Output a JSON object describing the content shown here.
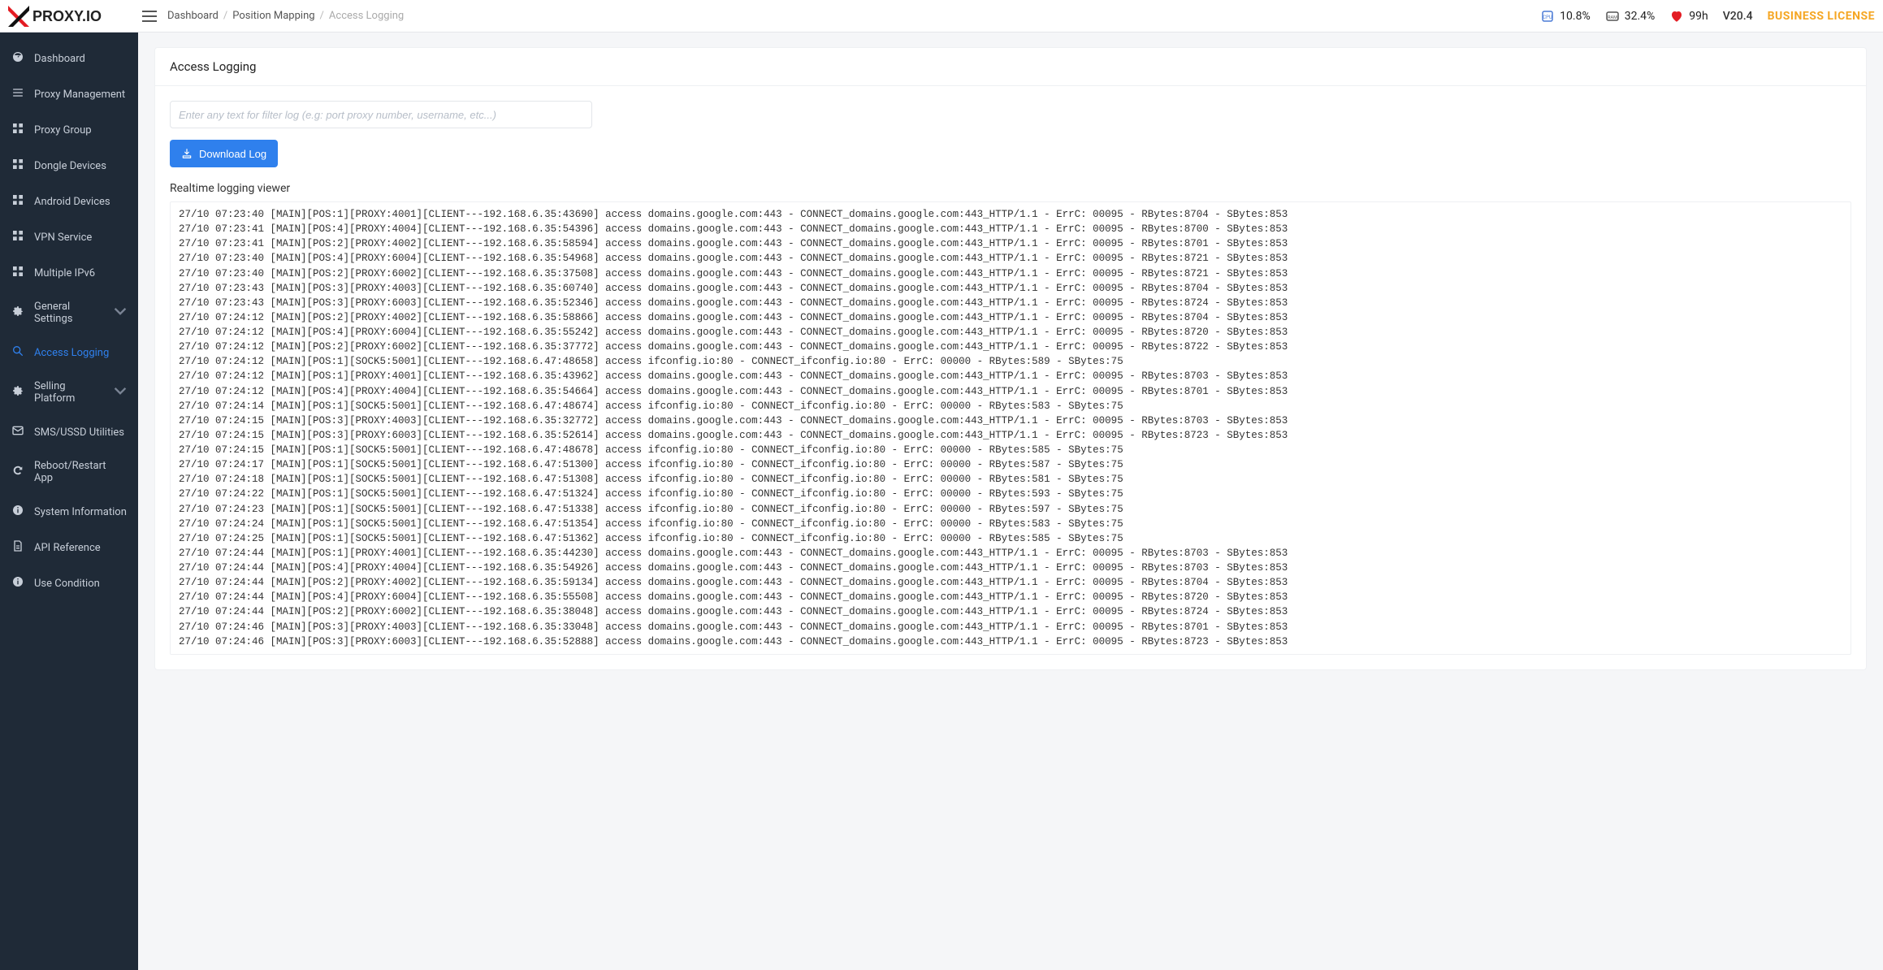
{
  "brand": {
    "name": "PROXY.IO"
  },
  "breadcrumb": {
    "items": [
      "Dashboard",
      "Position Mapping",
      "Access Logging"
    ]
  },
  "topStatus": {
    "cpu": "10.8%",
    "ram": "32.4%",
    "health": "99h",
    "version": "V20.4",
    "license": "BUSINESS LICENSE"
  },
  "sidebar": {
    "items": [
      {
        "icon": "speedometer",
        "label": "Dashboard",
        "chev": false
      },
      {
        "icon": "list",
        "label": "Proxy Management",
        "chev": false
      },
      {
        "icon": "grid",
        "label": "Proxy Group",
        "chev": false
      },
      {
        "icon": "grid",
        "label": "Dongle Devices",
        "chev": false
      },
      {
        "icon": "grid",
        "label": "Android Devices",
        "chev": false
      },
      {
        "icon": "grid",
        "label": "VPN Service",
        "chev": false
      },
      {
        "icon": "grid",
        "label": "Multiple IPv6",
        "chev": false
      },
      {
        "icon": "gear",
        "label": "General Settings",
        "chev": true
      },
      {
        "icon": "search",
        "label": "Access Logging",
        "chev": false,
        "active": true
      },
      {
        "icon": "gear",
        "label": "Selling Platform",
        "chev": true
      },
      {
        "icon": "envelope",
        "label": "SMS/USSD Utilities",
        "chev": false
      },
      {
        "icon": "refresh",
        "label": "Reboot/Restart App",
        "chev": false
      },
      {
        "icon": "info",
        "label": "System Information",
        "chev": false
      },
      {
        "icon": "doc",
        "label": "API Reference",
        "chev": false
      },
      {
        "icon": "info",
        "label": "Use Condition",
        "chev": false
      }
    ]
  },
  "page": {
    "title": "Access Logging",
    "filterPlaceholder": "Enter any text for filter log (e.g: port proxy number, username, etc...)",
    "downloadLabel": "Download Log",
    "realtimeTitle": "Realtime logging viewer",
    "logLines": [
      "27/10 07:23:40 [MAIN][POS:1][PROXY:4001][CLIENT---192.168.6.35:43690] access domains.google.com:443 - CONNECT_domains.google.com:443_HTTP/1.1 - ErrC: 00095 - RBytes:8704 - SBytes:853",
      "27/10 07:23:41 [MAIN][POS:4][PROXY:4004][CLIENT---192.168.6.35:54396] access domains.google.com:443 - CONNECT_domains.google.com:443_HTTP/1.1 - ErrC: 00095 - RBytes:8700 - SBytes:853",
      "27/10 07:23:41 [MAIN][POS:2][PROXY:4002][CLIENT---192.168.6.35:58594] access domains.google.com:443 - CONNECT_domains.google.com:443_HTTP/1.1 - ErrC: 00095 - RBytes:8701 - SBytes:853",
      "27/10 07:23:40 [MAIN][POS:4][PROXY:6004][CLIENT---192.168.6.35:54968] access domains.google.com:443 - CONNECT_domains.google.com:443_HTTP/1.1 - ErrC: 00095 - RBytes:8721 - SBytes:853",
      "27/10 07:23:40 [MAIN][POS:2][PROXY:6002][CLIENT---192.168.6.35:37508] access domains.google.com:443 - CONNECT_domains.google.com:443_HTTP/1.1 - ErrC: 00095 - RBytes:8721 - SBytes:853",
      "27/10 07:23:43 [MAIN][POS:3][PROXY:4003][CLIENT---192.168.6.35:60740] access domains.google.com:443 - CONNECT_domains.google.com:443_HTTP/1.1 - ErrC: 00095 - RBytes:8704 - SBytes:853",
      "27/10 07:23:43 [MAIN][POS:3][PROXY:6003][CLIENT---192.168.6.35:52346] access domains.google.com:443 - CONNECT_domains.google.com:443_HTTP/1.1 - ErrC: 00095 - RBytes:8724 - SBytes:853",
      "27/10 07:24:12 [MAIN][POS:2][PROXY:4002][CLIENT---192.168.6.35:58866] access domains.google.com:443 - CONNECT_domains.google.com:443_HTTP/1.1 - ErrC: 00095 - RBytes:8704 - SBytes:853",
      "27/10 07:24:12 [MAIN][POS:4][PROXY:6004][CLIENT---192.168.6.35:55242] access domains.google.com:443 - CONNECT_domains.google.com:443_HTTP/1.1 - ErrC: 00095 - RBytes:8720 - SBytes:853",
      "27/10 07:24:12 [MAIN][POS:2][PROXY:6002][CLIENT---192.168.6.35:37772] access domains.google.com:443 - CONNECT_domains.google.com:443_HTTP/1.1 - ErrC: 00095 - RBytes:8722 - SBytes:853",
      "27/10 07:24:12 [MAIN][POS:1][SOCK5:5001][CLIENT---192.168.6.47:48658] access ifconfig.io:80 - CONNECT_ifconfig.io:80 - ErrC: 00000 - RBytes:589 - SBytes:75",
      "27/10 07:24:12 [MAIN][POS:1][PROXY:4001][CLIENT---192.168.6.35:43962] access domains.google.com:443 - CONNECT_domains.google.com:443_HTTP/1.1 - ErrC: 00095 - RBytes:8703 - SBytes:853",
      "27/10 07:24:12 [MAIN][POS:4][PROXY:4004][CLIENT---192.168.6.35:54664] access domains.google.com:443 - CONNECT_domains.google.com:443_HTTP/1.1 - ErrC: 00095 - RBytes:8701 - SBytes:853",
      "27/10 07:24:14 [MAIN][POS:1][SOCK5:5001][CLIENT---192.168.6.47:48674] access ifconfig.io:80 - CONNECT_ifconfig.io:80 - ErrC: 00000 - RBytes:583 - SBytes:75",
      "27/10 07:24:15 [MAIN][POS:3][PROXY:4003][CLIENT---192.168.6.35:32772] access domains.google.com:443 - CONNECT_domains.google.com:443_HTTP/1.1 - ErrC: 00095 - RBytes:8703 - SBytes:853",
      "27/10 07:24:15 [MAIN][POS:3][PROXY:6003][CLIENT---192.168.6.35:52614] access domains.google.com:443 - CONNECT_domains.google.com:443_HTTP/1.1 - ErrC: 00095 - RBytes:8723 - SBytes:853",
      "27/10 07:24:15 [MAIN][POS:1][SOCK5:5001][CLIENT---192.168.6.47:48678] access ifconfig.io:80 - CONNECT_ifconfig.io:80 - ErrC: 00000 - RBytes:585 - SBytes:75",
      "27/10 07:24:17 [MAIN][POS:1][SOCK5:5001][CLIENT---192.168.6.47:51300] access ifconfig.io:80 - CONNECT_ifconfig.io:80 - ErrC: 00000 - RBytes:587 - SBytes:75",
      "27/10 07:24:18 [MAIN][POS:1][SOCK5:5001][CLIENT---192.168.6.47:51308] access ifconfig.io:80 - CONNECT_ifconfig.io:80 - ErrC: 00000 - RBytes:581 - SBytes:75",
      "27/10 07:24:22 [MAIN][POS:1][SOCK5:5001][CLIENT---192.168.6.47:51324] access ifconfig.io:80 - CONNECT_ifconfig.io:80 - ErrC: 00000 - RBytes:593 - SBytes:75",
      "27/10 07:24:23 [MAIN][POS:1][SOCK5:5001][CLIENT---192.168.6.47:51338] access ifconfig.io:80 - CONNECT_ifconfig.io:80 - ErrC: 00000 - RBytes:597 - SBytes:75",
      "27/10 07:24:24 [MAIN][POS:1][SOCK5:5001][CLIENT---192.168.6.47:51354] access ifconfig.io:80 - CONNECT_ifconfig.io:80 - ErrC: 00000 - RBytes:583 - SBytes:75",
      "27/10 07:24:25 [MAIN][POS:1][SOCK5:5001][CLIENT---192.168.6.47:51362] access ifconfig.io:80 - CONNECT_ifconfig.io:80 - ErrC: 00000 - RBytes:585 - SBytes:75",
      "27/10 07:24:44 [MAIN][POS:1][PROXY:4001][CLIENT---192.168.6.35:44230] access domains.google.com:443 - CONNECT_domains.google.com:443_HTTP/1.1 - ErrC: 00095 - RBytes:8703 - SBytes:853",
      "27/10 07:24:44 [MAIN][POS:4][PROXY:4004][CLIENT---192.168.6.35:54926] access domains.google.com:443 - CONNECT_domains.google.com:443_HTTP/1.1 - ErrC: 00095 - RBytes:8703 - SBytes:853",
      "27/10 07:24:44 [MAIN][POS:2][PROXY:4002][CLIENT---192.168.6.35:59134] access domains.google.com:443 - CONNECT_domains.google.com:443_HTTP/1.1 - ErrC: 00095 - RBytes:8704 - SBytes:853",
      "27/10 07:24:44 [MAIN][POS:4][PROXY:6004][CLIENT---192.168.6.35:55508] access domains.google.com:443 - CONNECT_domains.google.com:443_HTTP/1.1 - ErrC: 00095 - RBytes:8720 - SBytes:853",
      "27/10 07:24:44 [MAIN][POS:2][PROXY:6002][CLIENT---192.168.6.35:38048] access domains.google.com:443 - CONNECT_domains.google.com:443_HTTP/1.1 - ErrC: 00095 - RBytes:8724 - SBytes:853",
      "27/10 07:24:46 [MAIN][POS:3][PROXY:4003][CLIENT---192.168.6.35:33048] access domains.google.com:443 - CONNECT_domains.google.com:443_HTTP/1.1 - ErrC: 00095 - RBytes:8701 - SBytes:853",
      "27/10 07:24:46 [MAIN][POS:3][PROXY:6003][CLIENT---192.168.6.35:52888] access domains.google.com:443 - CONNECT_domains.google.com:443_HTTP/1.1 - ErrC: 00095 - RBytes:8723 - SBytes:853"
    ]
  }
}
